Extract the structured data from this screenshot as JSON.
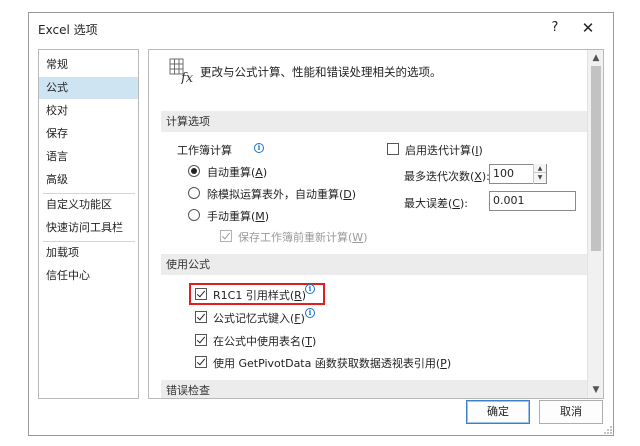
{
  "window": {
    "title": "Excel 选项",
    "help": "?",
    "close": "✕"
  },
  "nav": {
    "items": [
      "常规",
      "公式",
      "校对",
      "保存",
      "语言",
      "高级",
      "自定义功能区",
      "快速访问工具栏",
      "加载项",
      "信任中心"
    ],
    "active": "公式"
  },
  "intro": "更改与公式计算、性能和错误处理相关的选项。",
  "calc": {
    "section_title": "计算选项",
    "workbook_calc_label": "工作簿计算",
    "auto": {
      "label": "自动重算",
      "key": "A"
    },
    "auto_except": {
      "label": "除模拟运算表外，自动重算",
      "key": "D"
    },
    "manual": {
      "label": "手动重算",
      "key": "M"
    },
    "recalc_before_save": {
      "label": "保存工作簿前重新计算",
      "key": "W"
    },
    "iterative": {
      "label": "启用迭代计算",
      "key": "I"
    },
    "max_iterations": {
      "label": "最多迭代次数",
      "key": "X",
      "value": "100"
    },
    "max_change": {
      "label": "最大误差",
      "key": "C",
      "value": "0.001"
    }
  },
  "formulas": {
    "section_title": "使用公式",
    "r1c1": {
      "label": "R1C1 引用样式",
      "key": "R"
    },
    "autocomplete": {
      "label": "公式记忆式键入",
      "key": "F"
    },
    "table_names": {
      "label": "在公式中使用表名",
      "key": "T"
    },
    "getpivotdata": {
      "label": "使用 GetPivotData 函数获取数据透视表引用",
      "key": "P"
    }
  },
  "error_section_title": "错误检查",
  "buttons": {
    "ok": "确定",
    "cancel": "取消"
  },
  "colors": {
    "accent": "#1a73c9",
    "selected_nav": "#cfe4f3",
    "highlight_box": "#e0201e",
    "section_bg": "#ececec"
  },
  "icons": {
    "formula": "fx-formula-icon",
    "info": "info-icon"
  }
}
